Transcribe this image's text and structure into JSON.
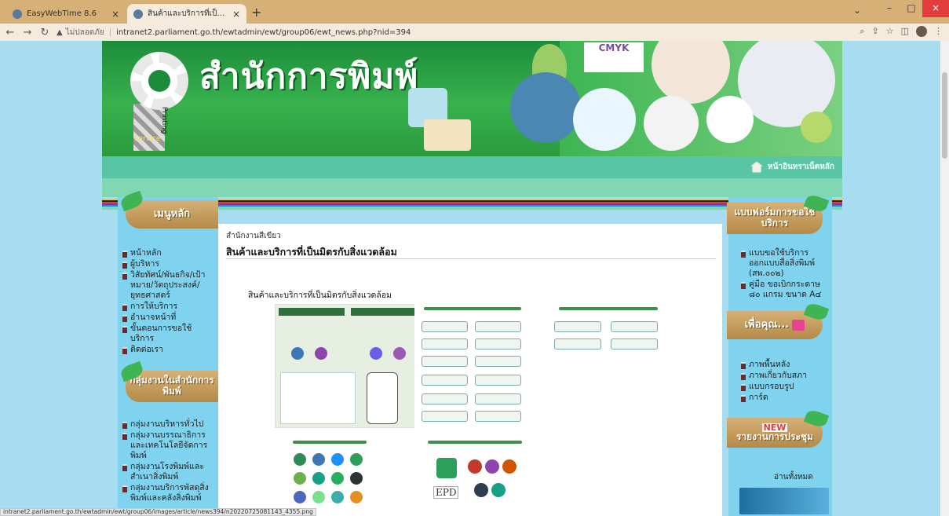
{
  "browser": {
    "tabs": [
      {
        "title": "EasyWebTime 8.6",
        "active": false
      },
      {
        "title": "สินค้าและบริการที่เป็นมิตรกับสิ่งแวดล้อม",
        "active": true
      }
    ],
    "security_label": "ไม่ปลอดภัย",
    "url": "intranet2.parliament.go.th/ewtadmin/ewt/group06/ewt_news.php?nid=394",
    "status_url": "intranet2.parliament.go.th/ewtadmin/ewt/group06/images/article/news394/n20220725081143_4355.png"
  },
  "header": {
    "site_title": "สำนักการพิมพ์",
    "logo_service": "Service",
    "logo_printing": "Printing",
    "cmyk": "CMYK"
  },
  "nav": {
    "home_link": "หน้าอินทราเน็ตหลัก"
  },
  "left_sidebar": {
    "main_menu_title": "เมนูหลัก",
    "main_menu": [
      "หน้าหลัก",
      "ผู้บริหาร",
      "วิสัยทัศน์/พันธกิจ/เป้าหมาย/วัตถุประสงค์/ยุทธศาสตร์",
      "การให้บริการ",
      "อำนาจหน้าที่",
      "ขั้นตอนการขอใช้บริการ",
      "ติดต่อเรา"
    ],
    "groups_title": "กลุ่มงานในสำนักการพิมพ์",
    "groups": [
      "กลุ่มงานบริหารทั่วไป",
      "กลุ่มงานบรรณาธิการและเทคโนโลยีจัดการพิมพ์",
      "กลุ่มงานโรงพิมพ์และสำเนาสิ่งพิมพ์",
      "กลุ่มงานบริการพัสดุสิ่งพิมพ์และคลังสิ่งพิมพ์"
    ]
  },
  "content": {
    "breadcrumb": "สำนักงานสีเขียว",
    "title": "สินค้าและบริการที่เป็นมิตรกับสิ่งแวดล้อม",
    "subtitle": "สินค้าและบริการที่เป็นมิตรกับสิ่งแวดล้อม"
  },
  "right_sidebar": {
    "forms_title": "แบบฟอร์มการขอใช้บริการ",
    "forms": [
      "แบบขอใช้บริการออกแบบสื่อสิ่งพิมพ์ (สพ.๐๐๒)",
      "คู่มือ ขอเบิกกระดาษ ๘๐ แกรม ขนาด A๔"
    ],
    "for_you_title": "เพื่อคุณ...",
    "for_you": [
      "ภาพพื้นหลัง",
      "ภาพเกี่ยวกับสภา",
      "แบบกรอบรูป",
      "การ์ด"
    ],
    "new_badge": "NEW",
    "report_title": "รายงานการประชุม",
    "read_all": "อ่านทั้งหมด"
  },
  "colors": {
    "page_bg": "#a8dcf0",
    "header_green": "#37b24d",
    "tag_tan": "#d6b076",
    "chrome": "#d6b076"
  }
}
